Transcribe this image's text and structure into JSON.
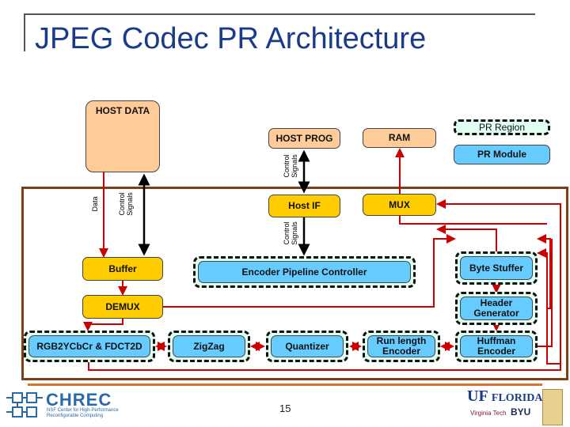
{
  "title": "JPEG Codec PR Architecture",
  "legend": {
    "pr_region": "PR Region",
    "pr_module": "PR Module"
  },
  "blocks": {
    "host_data": "HOST DATA",
    "host_prog": "HOST PROG",
    "ram": "RAM",
    "host_if": "Host IF",
    "mux": "MUX",
    "buffer": "Buffer",
    "demux": "DEMUX",
    "encoder_pipeline_controller": "Encoder Pipeline Controller",
    "byte_stuffer": "Byte Stuffer",
    "header_generator": "Header Generator",
    "rgb2ycbcr": "RGB2YCbCr & FDCT2D",
    "zigzag": "ZigZag",
    "quantizer": "Quantizer",
    "run_length_encoder": "Run length Encoder",
    "huffman_encoder": "Huffman Encoder"
  },
  "signals": {
    "data": "Data",
    "control_signals": "Control Signals"
  },
  "colors": {
    "host": "#FFCC99",
    "static": "#FFCC00",
    "pr_module": "#66CCFF",
    "pr_region": "#E0FFF0",
    "data_line": "#CC0000",
    "frame": "#7B3F1A"
  },
  "footer": {
    "page_number": "15",
    "logo_left": "CHREC NSF Center for High-Performance Reconfigurable Computing",
    "logo_right": "UF University of Florida, Virginia Tech, BYU"
  }
}
